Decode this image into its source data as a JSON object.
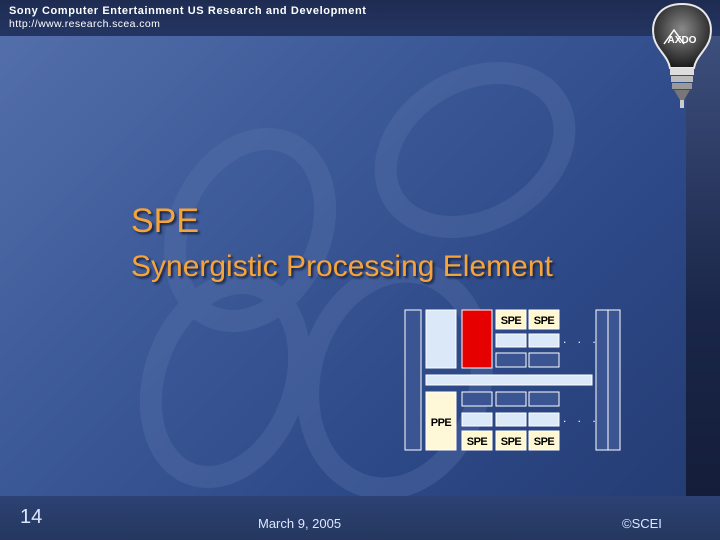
{
  "header": {
    "organization": "Sony Computer Entertainment US Research and Development",
    "url": "http://www.research.scea.com"
  },
  "logo": {
    "text": "AXDO",
    "icon": "lightbulb-icon"
  },
  "title": {
    "line1": "SPE",
    "line2": "Synergistic Processing Element"
  },
  "diagram": {
    "spe_label": "SPE",
    "ppe_label": "PPE",
    "ellipsis": ". . .",
    "colors": {
      "highlight": "#e60000",
      "box": "#dbe8f8",
      "ppe": "#fff8d8",
      "label_box": "#fff8d0"
    }
  },
  "footer": {
    "slide_number": "14",
    "date": "March 9, 2005",
    "copyright": "©SCEI"
  }
}
